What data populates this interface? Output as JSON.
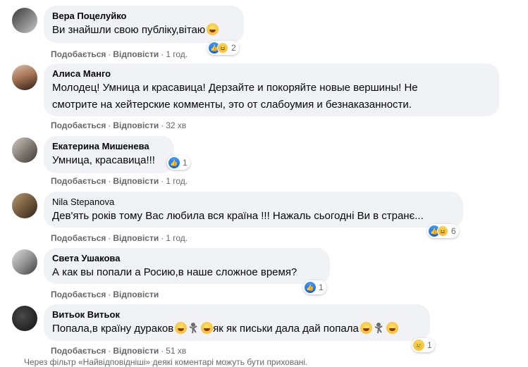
{
  "comments": [
    {
      "author": "Вера Поцелуйко",
      "text": "Ви знайшли свою публіку,вітаю",
      "like_label": "Подобається",
      "reply_label": "Відповісти",
      "time": "1 год.",
      "reactions": [
        "like",
        "haha"
      ],
      "reaction_count": "2"
    },
    {
      "author": "Алиса Манго",
      "text_lines": [
        "Молодец! Умница и красавица! Дерзайте и покоряйте новые вершины! Не",
        "смотрите на хейтерские комменты, это от слабоумия и безнаказанности."
      ],
      "like_label": "Подобається",
      "reply_label": "Відповісти",
      "time": "32 хв"
    },
    {
      "author": "Екатерина Мишенева",
      "text": "Умница, красавица!!!",
      "like_label": "Подобається",
      "reply_label": "Відповісти",
      "time": "1 год.",
      "reactions": [
        "like"
      ],
      "reaction_count": "1"
    },
    {
      "author": "Nila Stepanova",
      "text": "Дев'ять років тому Вас любила вся країна !!! Нажаль сьогодні Ви в странє...",
      "like_label": "Подобається",
      "reply_label": "Відповісти",
      "time": "1 год.",
      "reactions": [
        "like",
        "haha"
      ],
      "reaction_count": "6"
    },
    {
      "author": "Света Ушакова",
      "text": "А как вы попали а Росию,в наше сложное время?",
      "like_label": "Подобається",
      "reply_label": "Відповісти",
      "time": "",
      "reactions": [
        "like"
      ],
      "reaction_count": "1"
    },
    {
      "author": "Витьок Витьок",
      "text_a": "Попала,в країну дураков",
      "text_b": "як як письки дала дай попала",
      "like_label": "Подобається",
      "reply_label": "Відповісти",
      "time": "51 хв",
      "reactions": [
        "sad"
      ],
      "reaction_count": "1"
    }
  ],
  "footer": "Через фільтр «Найвідповідніші» деякі коментарі можуть бути приховані.",
  "colors": {
    "bubble": "#f0f2f5",
    "meta": "#65676b",
    "like": "#1877f2"
  }
}
